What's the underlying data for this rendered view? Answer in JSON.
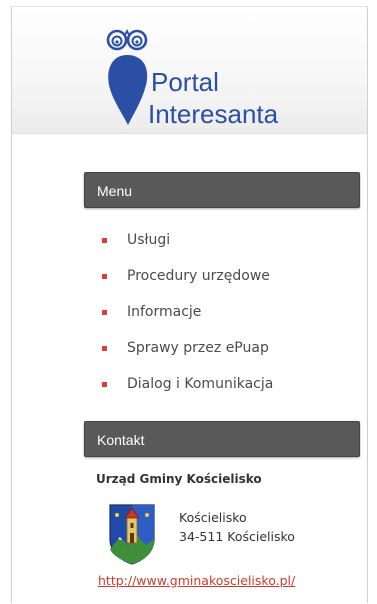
{
  "header": {
    "logo_line1": "Portal",
    "logo_line2": "Interesanta",
    "logo_color": "#2a4fa4"
  },
  "menu": {
    "title": "Menu",
    "bullet_color": "#e23b3b",
    "items": [
      {
        "label": "Usługi"
      },
      {
        "label": "Procedury urzędowe"
      },
      {
        "label": "Informacje"
      },
      {
        "label": "Sprawy przez ePuap"
      },
      {
        "label": "Dialog i Komunikacja"
      }
    ]
  },
  "contact": {
    "title": "Kontakt",
    "office_name": "Urząd Gminy Kościelisko",
    "address_line1": "Kościelisko",
    "address_line2": "34-511 Kościelisko",
    "website": "http://www.gminakoscielisko.pl/",
    "link_color": "#d23a2a"
  },
  "icons": {
    "logo": "owl-icon",
    "coat_of_arms": "coat-of-arms-icon",
    "bullet": "square-bullet-icon"
  }
}
